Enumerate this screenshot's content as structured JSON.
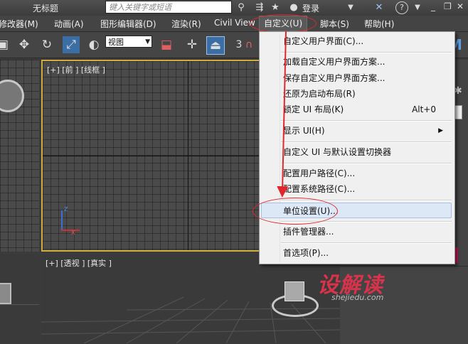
{
  "titlebar": {
    "title": "无标题",
    "search_placeholder": "键入关键字或短语",
    "login": "登录"
  },
  "menubar": {
    "items": [
      "修改器(M)",
      "动画(A)",
      "图形编辑器(D)",
      "渲染(R)",
      "Civil View",
      "自定义(U)",
      "脚本(S)",
      "帮助(H)"
    ]
  },
  "toolbar": {
    "view_select": "视图",
    "number": "3"
  },
  "viewports": {
    "front_label": "[+] [前 ] [线框 ]",
    "persp_label": "[+] [透视 ] [真实 ]"
  },
  "custom_menu": {
    "items": [
      {
        "label": "自定义用户界面(C)...",
        "shortcut": ""
      },
      {
        "label": "加载自定义用户界面方案...",
        "shortcut": ""
      },
      {
        "label": "保存自定义用户界面方案...",
        "shortcut": ""
      },
      {
        "label": "还原为启动布局(R)",
        "shortcut": ""
      },
      {
        "label": "锁定 UI 布局(K)",
        "shortcut": "Alt+0"
      },
      {
        "label": "显示 UI(H)",
        "shortcut": ""
      },
      {
        "label": "自定义 UI 与默认设置切换器",
        "shortcut": ""
      },
      {
        "label": "配置用户路径(C)...",
        "shortcut": ""
      },
      {
        "label": "配置系统路径(C)...",
        "shortcut": ""
      },
      {
        "label": "单位设置(U)...",
        "shortcut": ""
      },
      {
        "label": "插件管理器...",
        "shortcut": ""
      },
      {
        "label": "首选项(P)...",
        "shortcut": ""
      }
    ]
  },
  "watermark": {
    "brand": "设解读",
    "url": "shejiedu.com"
  },
  "colors": {
    "highlight": "#dde8f6",
    "annotation_red": "#e0282c",
    "active_viewport": "#cfae3a"
  }
}
